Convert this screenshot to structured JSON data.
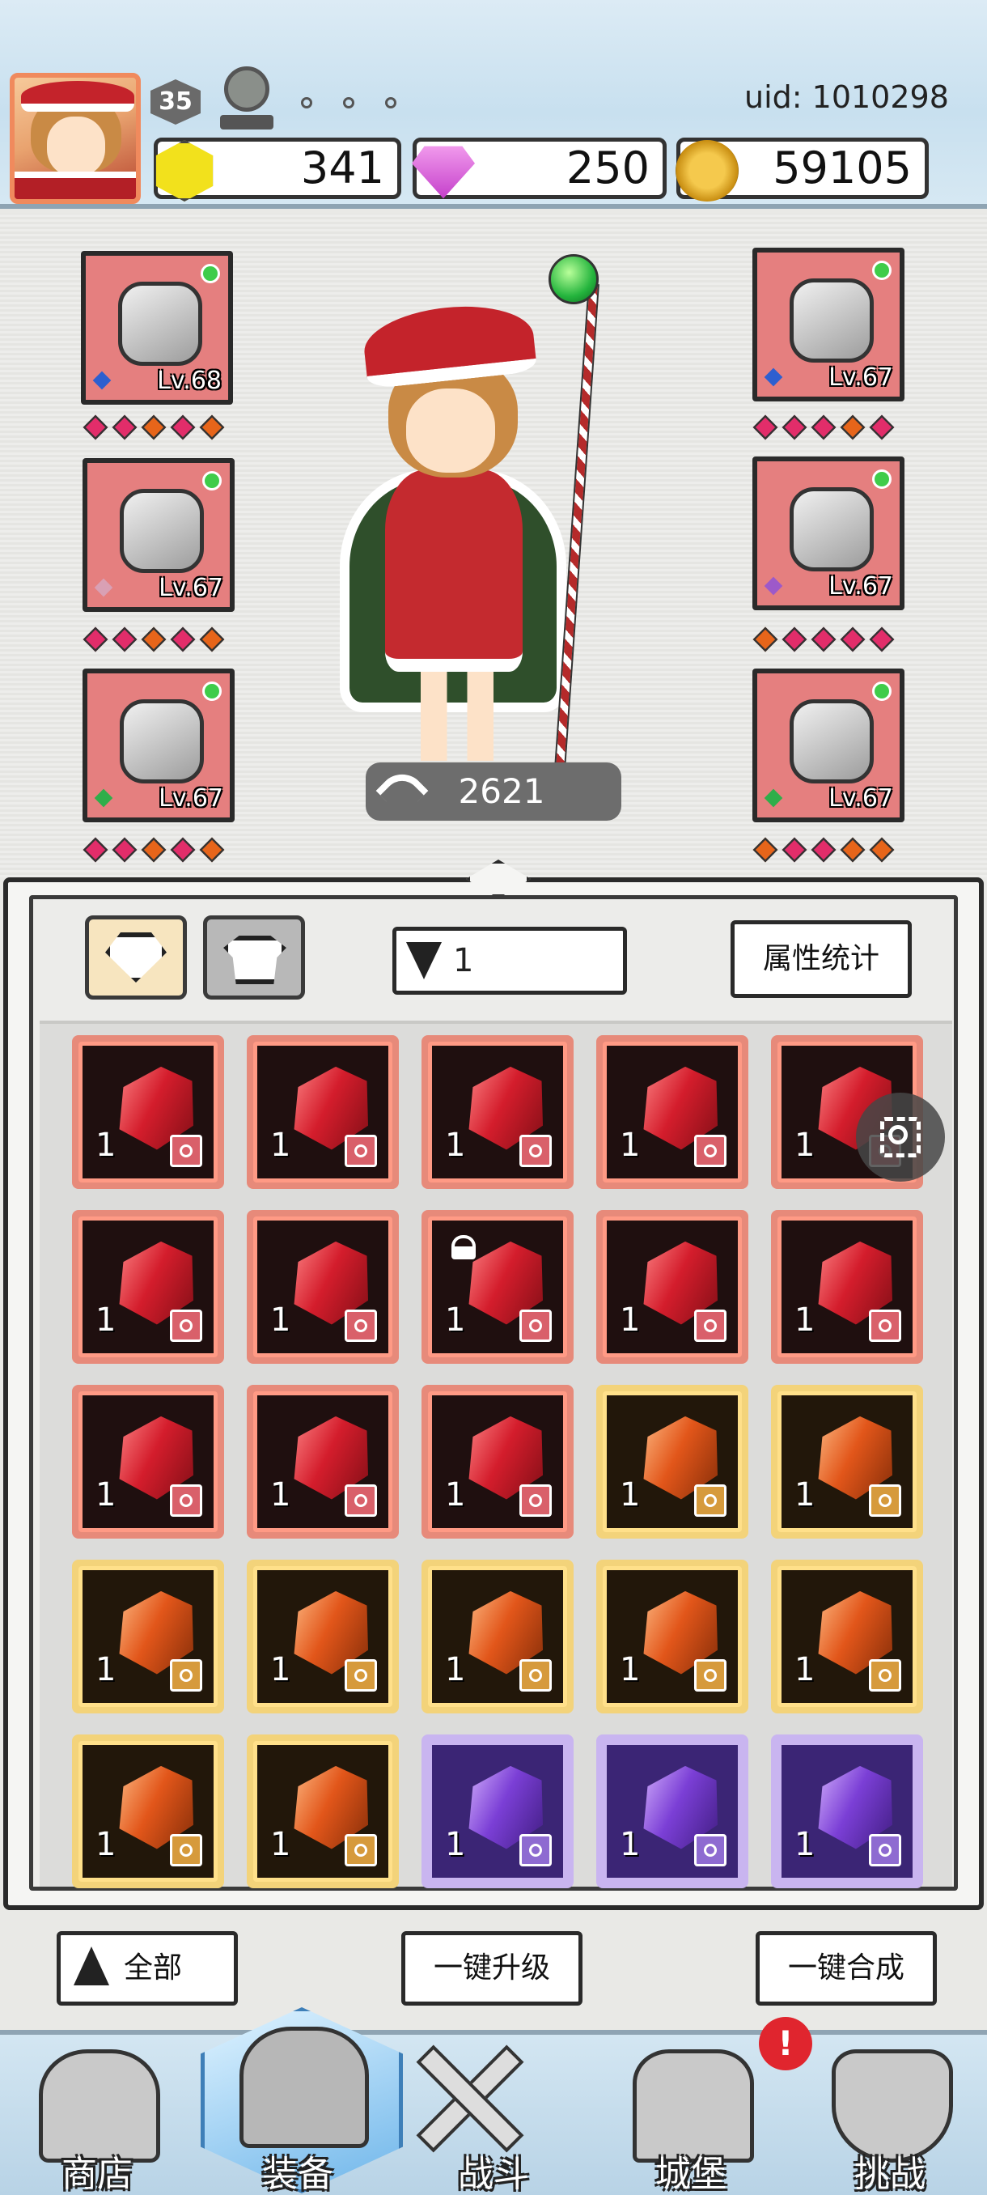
{
  "header": {
    "level": "35",
    "uid": "uid: 1010298",
    "currencies": {
      "gems": "341",
      "diamonds": "250",
      "coins": "59105"
    }
  },
  "equipment": {
    "left": [
      {
        "level": "Lv.68",
        "name": "hood-icon"
      },
      {
        "level": "Lv.67",
        "name": "cloak-icon"
      },
      {
        "level": "Lv.67",
        "name": "boot-icon"
      }
    ],
    "right": [
      {
        "level": "Lv.67",
        "name": "wand-icon"
      },
      {
        "level": "Lv.67",
        "name": "ring-icon"
      },
      {
        "level": "Lv.67",
        "name": "necklace-icon"
      }
    ],
    "power": "2621"
  },
  "inventory": {
    "filter_value": "1",
    "stats_button": "属性统计",
    "quantity": "1"
  },
  "actions": {
    "all": "全部",
    "upgrade": "一键升级",
    "merge": "一键合成"
  },
  "nav": {
    "shop": "商店",
    "equip": "装备",
    "battle": "战斗",
    "castle": "城堡",
    "challenge": "挑战",
    "alert": "!"
  },
  "colors": {
    "slot_bg": "#e57f7f",
    "rare_red": "#e78a7a",
    "rare_orange": "#f3d37a",
    "rare_purple": "#c9b5f0"
  }
}
